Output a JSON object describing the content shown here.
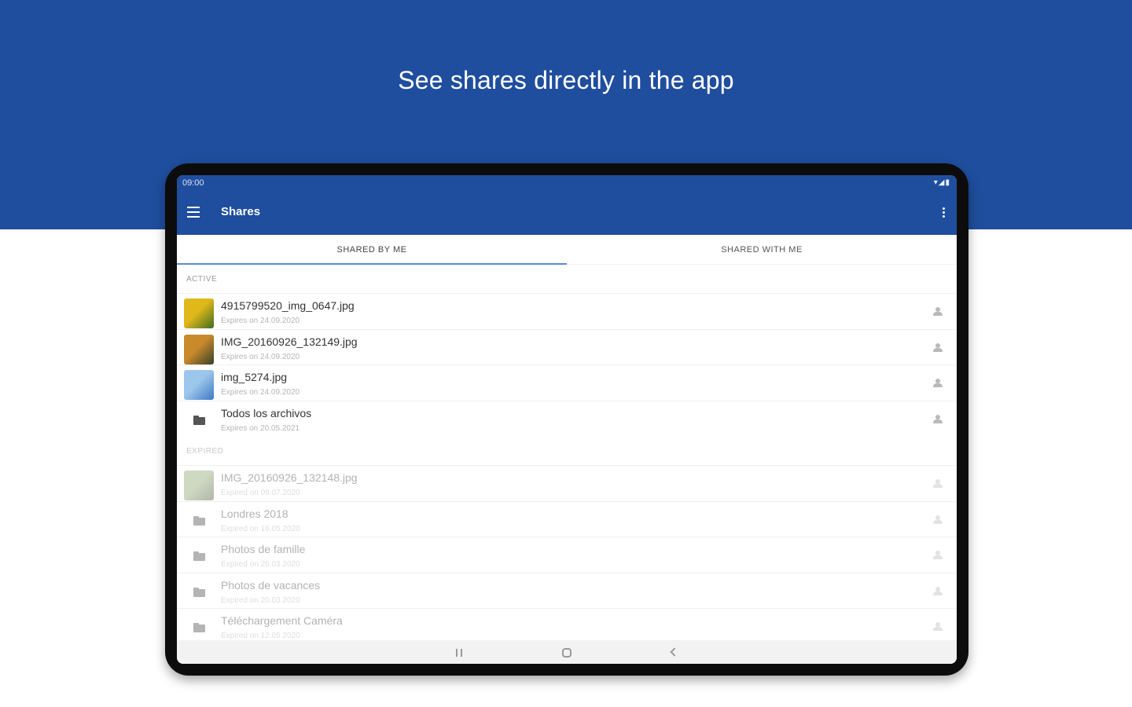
{
  "headline": "See shares directly in the app",
  "status_bar": {
    "time": "09:00",
    "icons": "▾◢▮"
  },
  "app_bar": {
    "title": "Shares",
    "menu_icon": "hamburger-menu-icon",
    "overflow_icon": "more-vert-icon"
  },
  "tabs": [
    {
      "label": "SHARED BY ME",
      "selected": true
    },
    {
      "label": "SHARED WITH ME",
      "selected": false
    }
  ],
  "sections": {
    "active_label": "ACTIVE",
    "expired_label": "EXPIRED"
  },
  "active_items": [
    {
      "name": "4915799520_img_0647.jpg",
      "subtitle": "Expires on 24.09.2020",
      "kind": "image",
      "thumb_colors": [
        "#e0b81a",
        "#3f6b22"
      ]
    },
    {
      "name": "IMG_20160926_132149.jpg",
      "subtitle": "Expires on 24.09.2020",
      "kind": "image",
      "thumb_colors": [
        "#c98a2b",
        "#35402a"
      ]
    },
    {
      "name": "img_5274.jpg",
      "subtitle": "Expires on 24.09.2020",
      "kind": "image",
      "thumb_colors": [
        "#9cc6ec",
        "#3f79c4"
      ]
    },
    {
      "name": "Todos los archivos",
      "subtitle": "Expires on 20.05.2021",
      "kind": "folder"
    }
  ],
  "expired_items": [
    {
      "name": "IMG_20160926_132148.jpg",
      "subtitle": "Expired on 09.07.2020",
      "kind": "image",
      "thumb_colors": [
        "#a8b98f",
        "#6f7e62"
      ]
    },
    {
      "name": "Londres 2018",
      "subtitle": "Expired on 16.05.2020",
      "kind": "folder"
    },
    {
      "name": "Photos de famille",
      "subtitle": "Expired on 26.03.2020",
      "kind": "folder"
    },
    {
      "name": "Photos de vacances",
      "subtitle": "Expired on 20.03.2020",
      "kind": "folder"
    },
    {
      "name": "Téléchargement Caméra",
      "subtitle": "Expired on 12.05.2020",
      "kind": "folder"
    }
  ],
  "nav_bar": {
    "recents_icon": "recents-icon",
    "home_icon": "home-icon",
    "back_icon": "back-icon"
  },
  "colors": {
    "brand_blue": "#1f4e9e",
    "tab_indicator": "#5b8bd8"
  }
}
